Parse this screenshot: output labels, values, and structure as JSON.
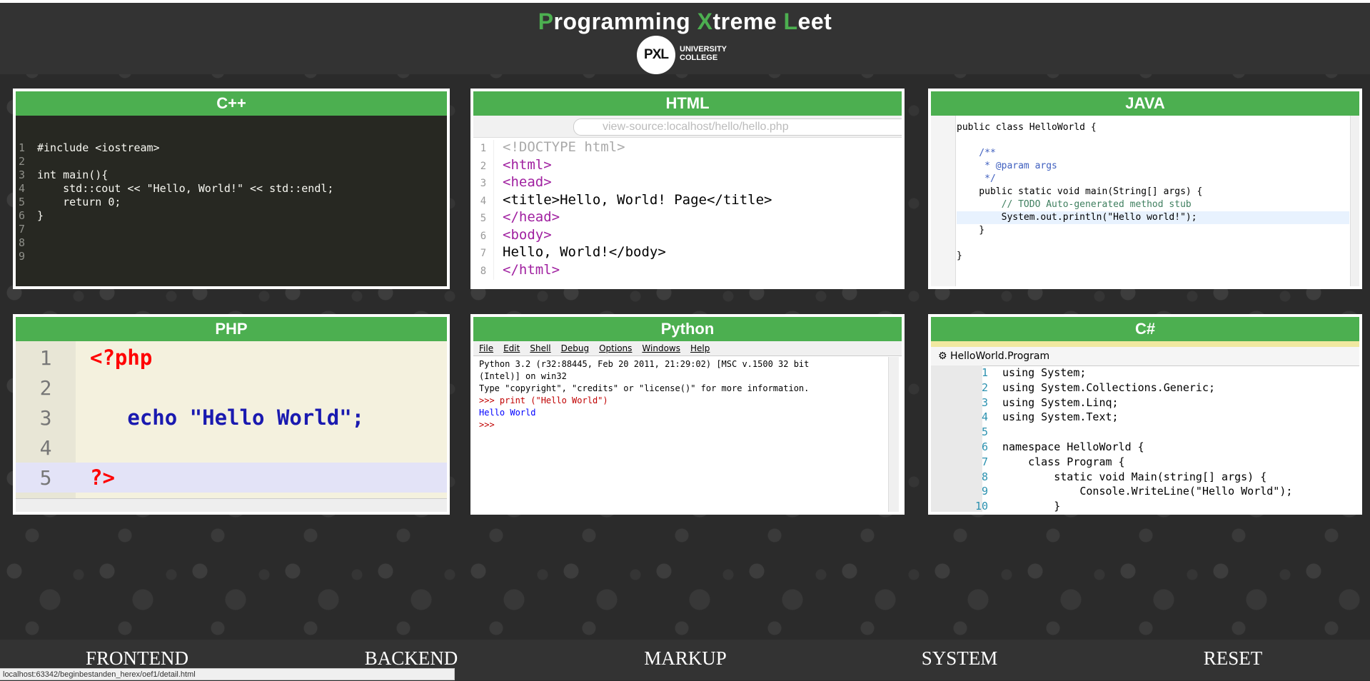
{
  "header": {
    "title_parts": [
      {
        "accent": "P",
        "rest": "rogramming "
      },
      {
        "accent": "X",
        "rest": "treme "
      },
      {
        "accent": "L",
        "rest": "eet"
      }
    ],
    "logo_mark": "PXL",
    "logo_line1": "UNIVERSITY",
    "logo_line2": "COLLEGE"
  },
  "cards": {
    "cpp": {
      "title": "C++",
      "lines": [
        "#include <iostream>",
        "",
        "int main(){",
        "    std::cout << \"Hello, World!\" << std::endl;",
        "    return 0;",
        "}",
        "",
        "",
        ""
      ]
    },
    "html": {
      "title": "HTML",
      "url": "view-source:localhost/hello/hello.php",
      "lines": [
        "<!DOCTYPE html>",
        "<html>",
        "<head>",
        "<title>Hello, World! Page</title>",
        "</head>",
        "<body>",
        "Hello, World!</body>",
        "</html>"
      ]
    },
    "java": {
      "title": "JAVA",
      "lines": [
        "public class HelloWorld {",
        "",
        "    /**",
        "     * @param args",
        "     */",
        "    public static void main(String[] args) {",
        "        // TODO Auto-generated method stub",
        "        System.out.println(\"Hello world!\");",
        "    }",
        "",
        "}"
      ]
    },
    "php": {
      "title": "PHP",
      "lines": [
        "<?php",
        "",
        "   echo \"Hello World\";",
        "",
        "?>"
      ]
    },
    "python": {
      "title": "Python",
      "menu": [
        "File",
        "Edit",
        "Shell",
        "Debug",
        "Options",
        "Windows",
        "Help"
      ],
      "lines": [
        "Python 3.2 (r32:88445, Feb 20 2011, 21:29:02) [MSC v.1500 32 bit",
        "(Intel)] on win32",
        "Type \"copyright\", \"credits\" or \"license()\" for more information.",
        ">>> print (\"Hello World\")",
        "Hello World",
        ">>> "
      ]
    },
    "csharp": {
      "title": "C#",
      "nav": "HelloWorld.Program",
      "lines": [
        "using System;",
        "using System.Collections.Generic;",
        "using System.Linq;",
        "using System.Text;",
        "",
        "namespace HelloWorld {",
        "    class Program {",
        "        static void Main(string[] args) {",
        "            Console.WriteLine(\"Hello World\");",
        "        }"
      ]
    }
  },
  "nav": {
    "items": [
      "FRONTEND",
      "BACKEND",
      "MARKUP",
      "SYSTEM",
      "RESET"
    ]
  },
  "status_url": "localhost:63342/beginbestanden_herex/oef1/detail.html",
  "colors": {
    "accent": "#4caf50",
    "bar": "#333333"
  }
}
